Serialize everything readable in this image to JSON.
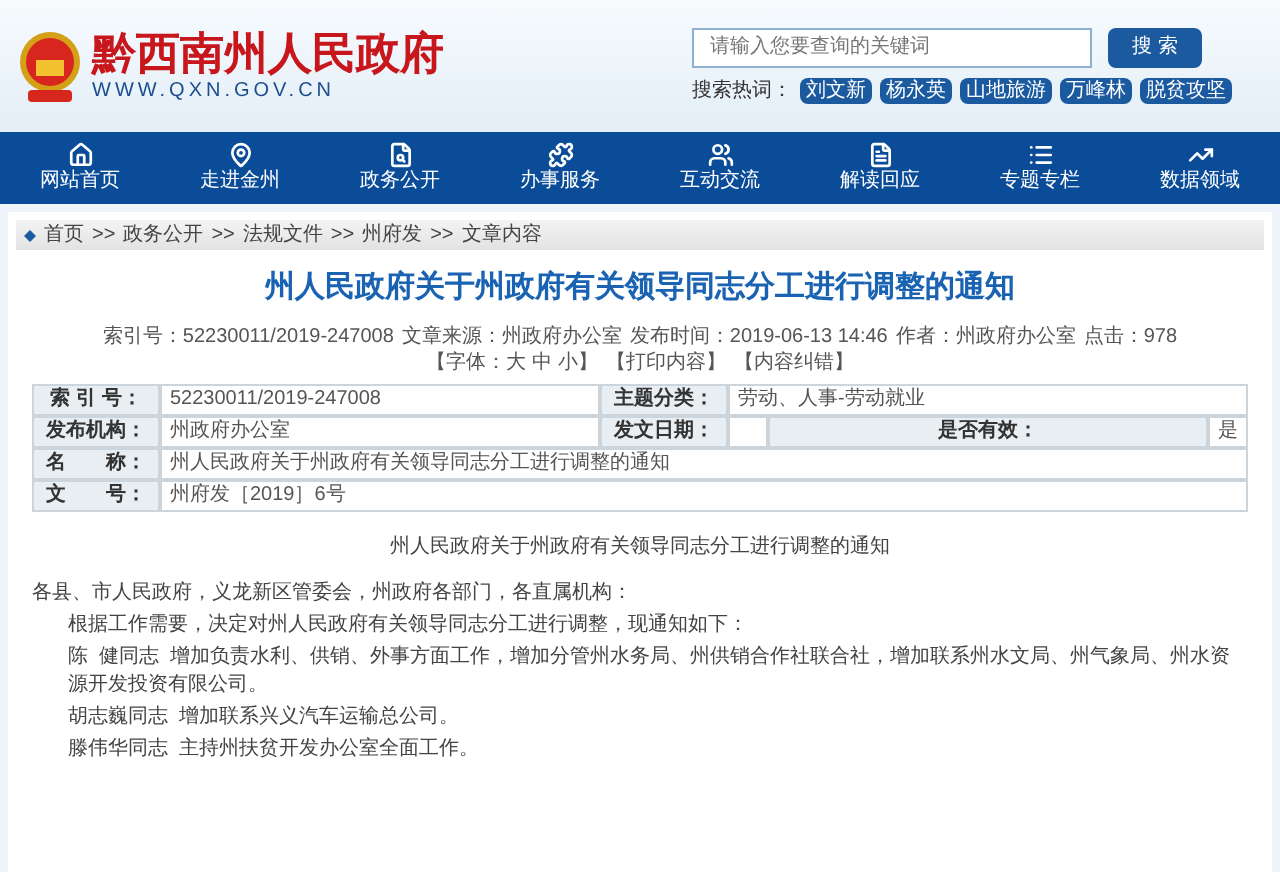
{
  "header": {
    "site_title": "黔西南州人民政府",
    "site_url": "WWW.QXN.GOV.CN",
    "search": {
      "placeholder": "请输入您要查询的关键词",
      "button": "搜 索"
    },
    "hot_label": "搜索热词：",
    "hot_words": [
      "刘文新",
      "杨永英",
      "山地旅游",
      "万峰林",
      "脱贫攻坚"
    ]
  },
  "nav": [
    {
      "label": "网站首页"
    },
    {
      "label": "走进金州"
    },
    {
      "label": "政务公开"
    },
    {
      "label": "办事服务"
    },
    {
      "label": "互动交流"
    },
    {
      "label": "解读回应"
    },
    {
      "label": "专题专栏"
    },
    {
      "label": "数据领域"
    }
  ],
  "breadcrumb": [
    {
      "label": "首页"
    },
    {
      "sep": ">>",
      "label": "政务公开"
    },
    {
      "sep": ">>",
      "label": "法规文件"
    },
    {
      "sep": ">>",
      "label": "州府发"
    },
    {
      "sep": ">>",
      "label": "文章内容"
    }
  ],
  "article_title": "州人民政府关于州政府有关领导同志分工进行调整的通知",
  "meta": [
    "索引号：52230011/2019-247008",
    "文章来源：州政府办公室",
    "发布时间：2019-06-13 14:46",
    "作者：州政府办公室",
    "点击：978",
    "【字体：大 中 小】",
    "【打印内容】",
    "【内容纠错】"
  ],
  "info_table": [
    [
      {
        "kind": "label",
        "text": "索 引 号："
      },
      {
        "kind": "value",
        "text": "52230011/2019-247008"
      },
      {
        "kind": "label",
        "text": "主题分类："
      },
      {
        "kind": "value",
        "text": "劳动、人事-劳动就业"
      }
    ],
    [
      {
        "kind": "label",
        "text": "发布机构："
      },
      {
        "kind": "value",
        "text": "州政府办公室"
      },
      {
        "kind": "label",
        "text": "发文日期："
      },
      {
        "kind": "blank"
      },
      {
        "kind": "label",
        "text": "是否有效："
      },
      {
        "kind": "value",
        "text": "是"
      }
    ],
    [
      {
        "kind": "label",
        "text": "名　　称："
      },
      {
        "kind": "value",
        "text": "州人民政府关于州政府有关领导同志分工进行调整的通知"
      }
    ],
    [
      {
        "kind": "label",
        "text": "文　　号："
      },
      {
        "kind": "value",
        "text": "州府发［2019］6号"
      }
    ]
  ],
  "body": {
    "title": "州人民政府关于州政府有关领导同志分工进行调整的通知",
    "greeting": "各县、市人民政府，义龙新区管委会，州政府各部门，各直属机构：",
    "paragraphs": [
      "根据工作需要，决定对州人民政府有关领导同志分工进行调整，现通知如下：",
      "陈  健同志  增加负责水利、供销、外事方面工作，增加分管州水务局、州供销合作社联合社，增加联系州水文局、州气象局、州水资源开发投资有限公司。",
      "胡志巍同志  增加联系兴义汽车运输总公司。",
      "滕伟华同志  主持州扶贫开发办公室全面工作。"
    ]
  }
}
